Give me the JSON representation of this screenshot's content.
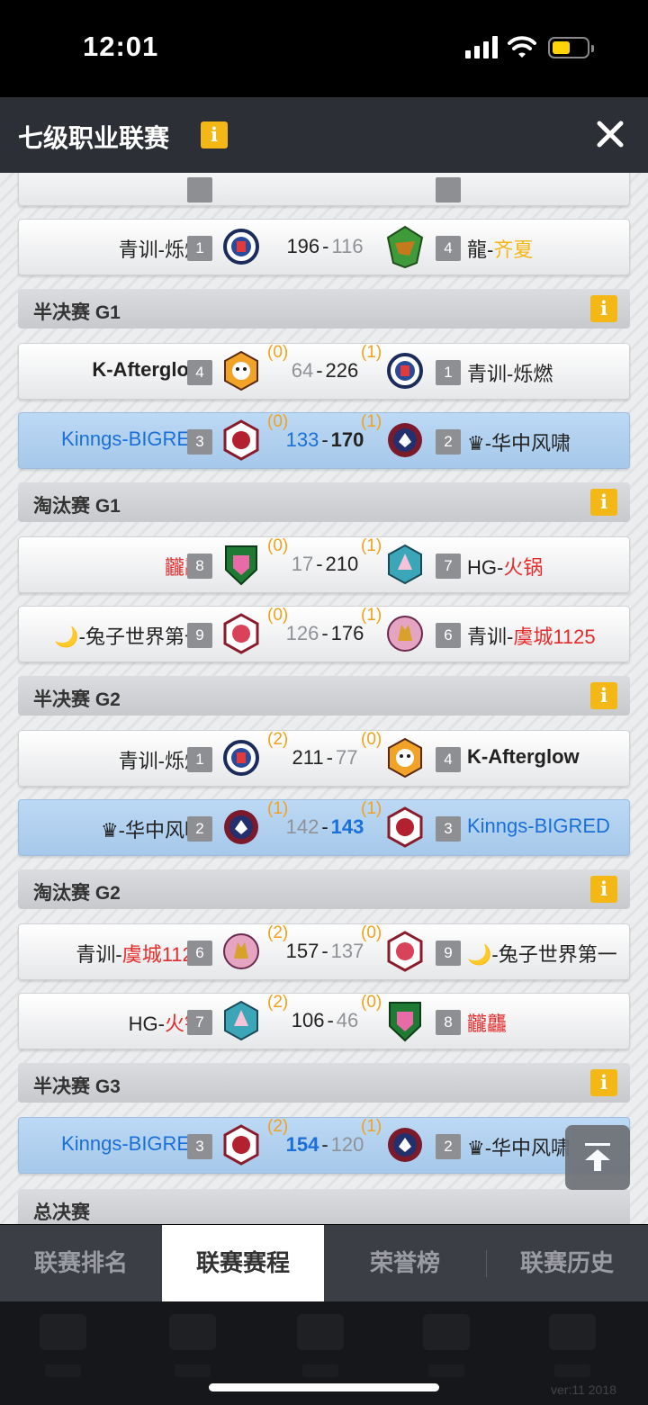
{
  "status": {
    "time": "12:01"
  },
  "header": {
    "title": "七级职业联赛",
    "info": "i",
    "close_icon": "close-icon"
  },
  "colors": {
    "accent_yellow": "#f3b716",
    "win_count": "#f2a11b",
    "highlight_blue": "#1a6fd8",
    "red_team": "#e62b2b",
    "tab_bg": "#3b3e45"
  },
  "partial_match": {
    "left_name": "青训-烁燃",
    "left_seed": "1",
    "score_left": "196",
    "score_right": "116",
    "right_name_prefix": "龍-",
    "right_name_rest": "齐夏",
    "right_seed": "4"
  },
  "sections": [
    {
      "label": "半决赛 G1",
      "info": "i",
      "matches": [
        {
          "left_name": "K-Afterglow",
          "left_seed": "4",
          "left_wins": "(0)",
          "score_left": "64",
          "score_right": "226",
          "right_wins": "(1)",
          "right_seed": "1",
          "right_name": "青训-烁燃"
        },
        {
          "left_name": "Kinngs-BIGRED",
          "left_seed": "3",
          "left_wins": "(0)",
          "score_left": "133",
          "score_right": "170",
          "right_wins": "(1)",
          "right_seed": "2",
          "right_name": "♛-华中风啸"
        }
      ]
    },
    {
      "label": "淘汰赛 G1",
      "info": "i",
      "matches": [
        {
          "left_name": "龖龘",
          "left_seed": "8",
          "left_wins": "(0)",
          "score_left": "17",
          "score_right": "210",
          "right_wins": "(1)",
          "right_seed": "7",
          "right_name_prefix": "HG-",
          "right_name_rest": "火锅"
        },
        {
          "left_name": "🌙-兔子世界第一",
          "left_seed": "9",
          "left_wins": "(0)",
          "score_left": "126",
          "score_right": "176",
          "right_wins": "(1)",
          "right_seed": "6",
          "right_name_prefix": "青训-",
          "right_name_rest": "虞城1125"
        }
      ]
    },
    {
      "label": "半决赛 G2",
      "info": "i",
      "matches": [
        {
          "left_name": "青训-烁燃",
          "left_seed": "1",
          "left_wins": "(2)",
          "score_left": "211",
          "score_right": "77",
          "right_wins": "(0)",
          "right_seed": "4",
          "right_name": "K-Afterglow"
        },
        {
          "left_name": "♛-华中风啸",
          "left_seed": "2",
          "left_wins": "(1)",
          "score_left": "142",
          "score_right": "143",
          "right_wins": "(1)",
          "right_seed": "3",
          "right_name": "Kinngs-BIGRED"
        }
      ]
    },
    {
      "label": "淘汰赛 G2",
      "info": "i",
      "matches": [
        {
          "left_name_prefix": "青训-",
          "left_name_rest": "虞城1125",
          "left_seed": "6",
          "left_wins": "(2)",
          "score_left": "157",
          "score_right": "137",
          "right_wins": "(0)",
          "right_seed": "9",
          "right_name": "🌙-兔子世界第一"
        },
        {
          "left_name_prefix": "HG-",
          "left_name_rest": "火锅",
          "left_seed": "7",
          "left_wins": "(2)",
          "score_left": "106",
          "score_right": "46",
          "right_wins": "(0)",
          "right_seed": "8",
          "right_name": "龖龘"
        }
      ]
    },
    {
      "label": "半决赛 G3",
      "info": "i",
      "matches": [
        {
          "left_name": "Kinngs-BIGRED",
          "left_seed": "3",
          "left_wins": "(2)",
          "score_left": "154",
          "score_right": "120",
          "right_wins": "(1)",
          "right_seed": "2",
          "right_name": "♛-华中风啸"
        }
      ]
    },
    {
      "label": "总决赛"
    }
  ],
  "tabs": [
    "联赛排名",
    "联赛赛程",
    "荣誉榜",
    "联赛历史"
  ],
  "active_tab": "联赛赛程",
  "version": "ver:11  2018"
}
